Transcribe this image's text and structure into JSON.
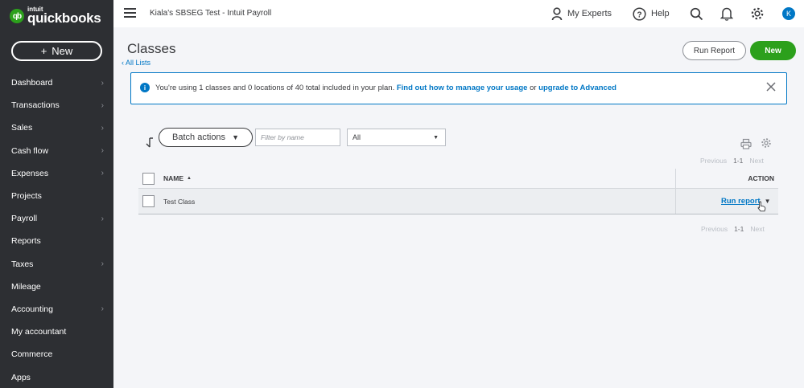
{
  "brand": {
    "intuit": "intuit",
    "name": "quickbooks",
    "mark": "qb",
    "accent": "#2ca01c"
  },
  "sidebar": {
    "new_label": "New",
    "items": [
      {
        "label": "Dashboard",
        "chevron": true
      },
      {
        "label": "Transactions",
        "chevron": true
      },
      {
        "label": "Sales",
        "chevron": true
      },
      {
        "label": "Cash flow",
        "chevron": true
      },
      {
        "label": "Expenses",
        "chevron": true
      },
      {
        "label": "Projects",
        "chevron": false
      },
      {
        "label": "Payroll",
        "chevron": true
      },
      {
        "label": "Reports",
        "chevron": false
      },
      {
        "label": "Taxes",
        "chevron": true
      },
      {
        "label": "Mileage",
        "chevron": false
      },
      {
        "label": "Accounting",
        "chevron": true
      },
      {
        "label": "My accountant",
        "chevron": false
      },
      {
        "label": "Commerce",
        "chevron": false
      },
      {
        "label": "Apps",
        "chevron": false
      }
    ]
  },
  "topbar": {
    "company": "Kiala's SBSEG Test - Intuit Payroll",
    "my_experts": "My Experts",
    "help": "Help",
    "avatar_initial": "K"
  },
  "page": {
    "title": "Classes",
    "back_link": "All Lists",
    "run_report_label": "Run Report",
    "new_label": "New"
  },
  "banner": {
    "text": "You're using 1 classes and 0 locations of 40 total included in your plan.",
    "link1": "Find out how to manage your usage",
    "connector": "or",
    "link2": "upgrade to Advanced"
  },
  "toolbar": {
    "batch_actions": "Batch actions",
    "filter_placeholder": "Filter by name",
    "select_value": "All"
  },
  "pager": {
    "previous": "Previous",
    "range": "1-1",
    "next": "Next"
  },
  "table": {
    "col_name": "NAME",
    "col_action": "ACTION",
    "rows": [
      {
        "name": "Test Class",
        "action": "Run report"
      }
    ]
  }
}
